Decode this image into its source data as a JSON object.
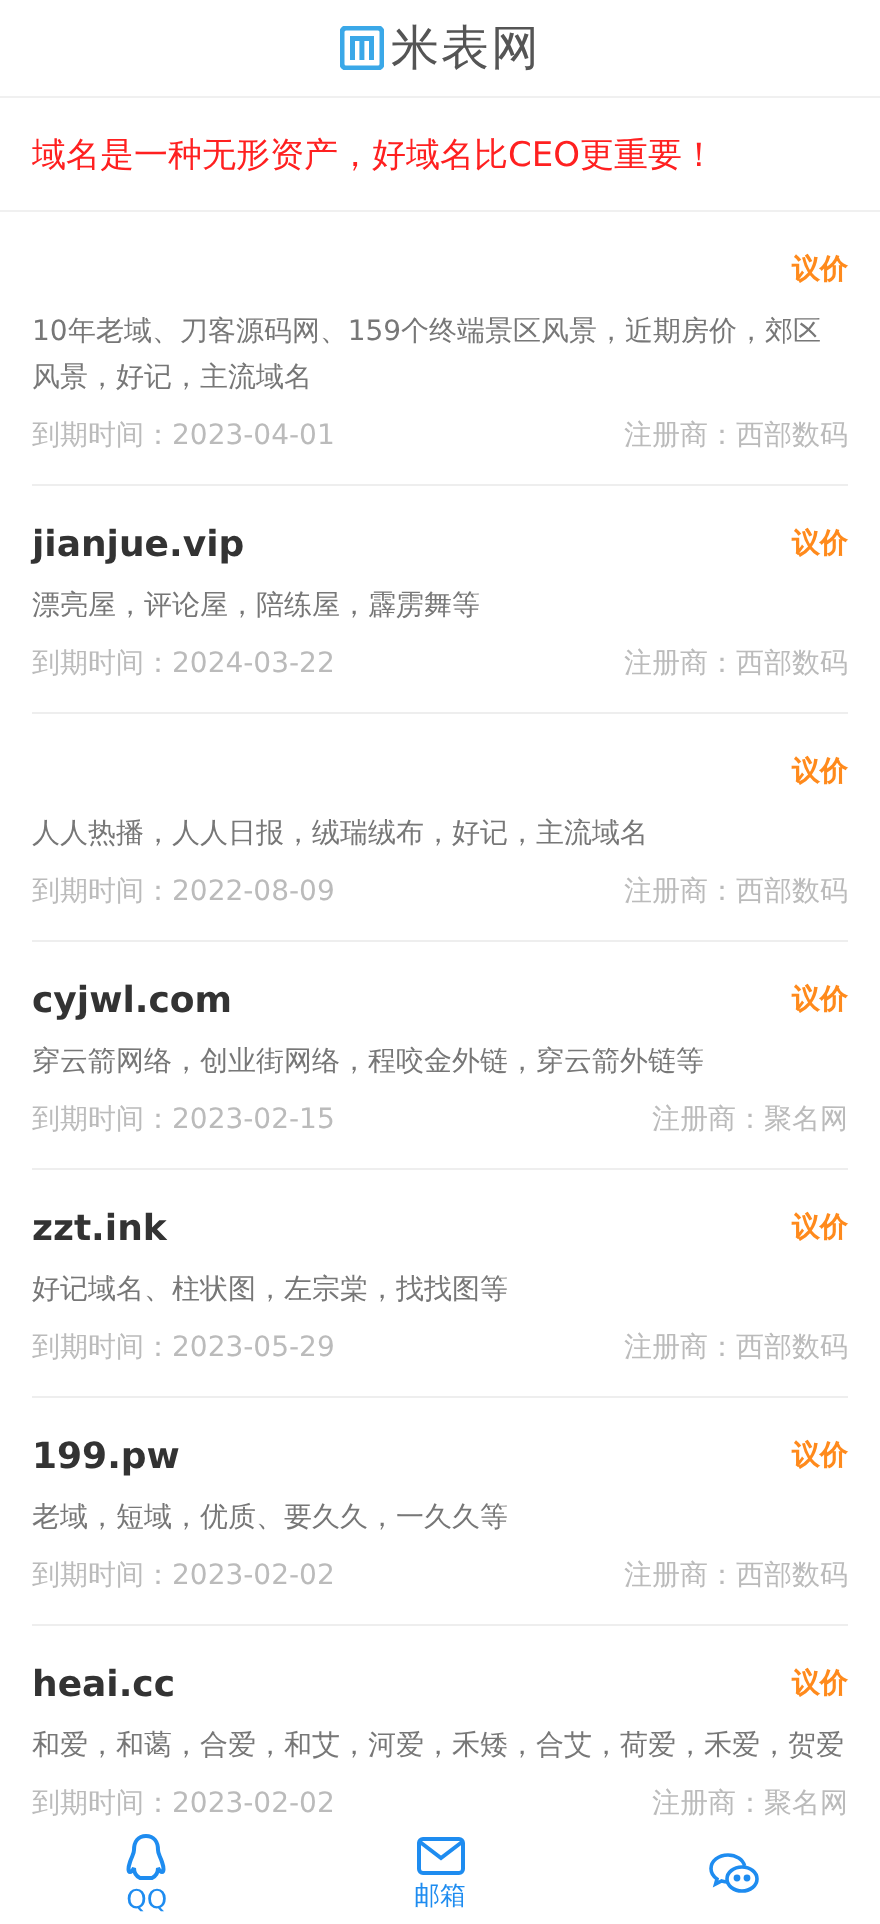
{
  "header": {
    "logo_text": "米表网"
  },
  "slogan": "域名是一种无形资产，好域名比CEO更重要！",
  "domains": [
    {
      "price": "议价",
      "description": "10年老域、刀客源码网、159个终端景区风景，近期房价，郊区风景，好记，主流域名",
      "expiry": "到期时间：2023-04-01",
      "registrar": "注册商：西部数码"
    },
    {
      "name": "jianjue.vip",
      "price": "议价",
      "description": "漂亮屋，评论屋，陪练屋，霹雳舞等",
      "expiry": "到期时间：2024-03-22",
      "registrar": "注册商：西部数码"
    },
    {
      "price": "议价",
      "description": "人人热播，人人日报，绒瑞绒布，好记，主流域名",
      "expiry": "到期时间：2022-08-09",
      "registrar": "注册商：西部数码"
    },
    {
      "name": "cyjwl.com",
      "price": "议价",
      "description": "穿云箭网络，创业街网络，程咬金外链，穿云箭外链等",
      "expiry": "到期时间：2023-02-15",
      "registrar": "注册商：聚名网"
    },
    {
      "name": "zzt.ink",
      "price": "议价",
      "description": "好记域名、柱状图，左宗棠，找找图等",
      "expiry": "到期时间：2023-05-29",
      "registrar": "注册商：西部数码"
    },
    {
      "name": "199.pw",
      "price": "议价",
      "description": "老域，短域，优质、要久久，一久久等",
      "expiry": "到期时间：2023-02-02",
      "registrar": "注册商：西部数码"
    },
    {
      "name": "heai.cc",
      "price": "议价",
      "description": "和爱，和蔼，合爱，和艾，河爱，禾矮，合艾，荷爱，禾爱，贺爱",
      "expiry": "到期时间：2023-02-02",
      "registrar": "注册商：聚名网"
    }
  ],
  "bottom_nav": [
    {
      "kind": "qq",
      "label": "QQ"
    },
    {
      "kind": "mail",
      "label": "邮箱"
    },
    {
      "kind": "wechat"
    }
  ]
}
